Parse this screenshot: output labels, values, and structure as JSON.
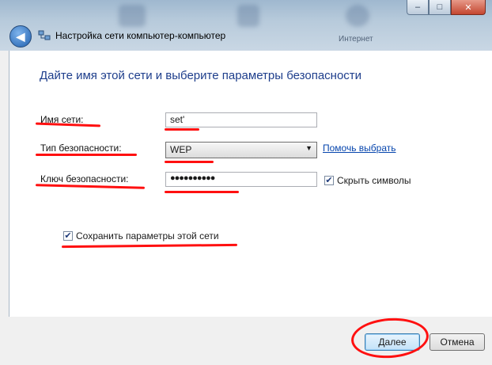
{
  "window": {
    "title": "Настройка сети компьютер-компьютер",
    "background_label": "Интернет",
    "min_glyph": "–",
    "max_glyph": "□",
    "close_glyph": "✕",
    "back_glyph": "◀"
  },
  "heading": "Дайте имя этой сети и выберите параметры безопасности",
  "form": {
    "network_name_label": "Имя сети:",
    "network_name_value": "set'",
    "security_type_label": "Тип безопасности:",
    "security_type_value": "WEP",
    "help_link": "Помочь выбрать",
    "security_key_label": "Ключ безопасности:",
    "security_key_value": "●●●●●●●●●●",
    "hide_chars_label": "Скрыть символы",
    "hide_chars_checked": true,
    "save_settings_label": "Сохранить параметры этой сети",
    "save_settings_checked": true,
    "check_glyph": "✔"
  },
  "buttons": {
    "next": "Далее",
    "cancel": "Отмена"
  },
  "colors": {
    "annotation": "#ff1010",
    "heading": "#1e3e8c",
    "link": "#0645ad"
  }
}
